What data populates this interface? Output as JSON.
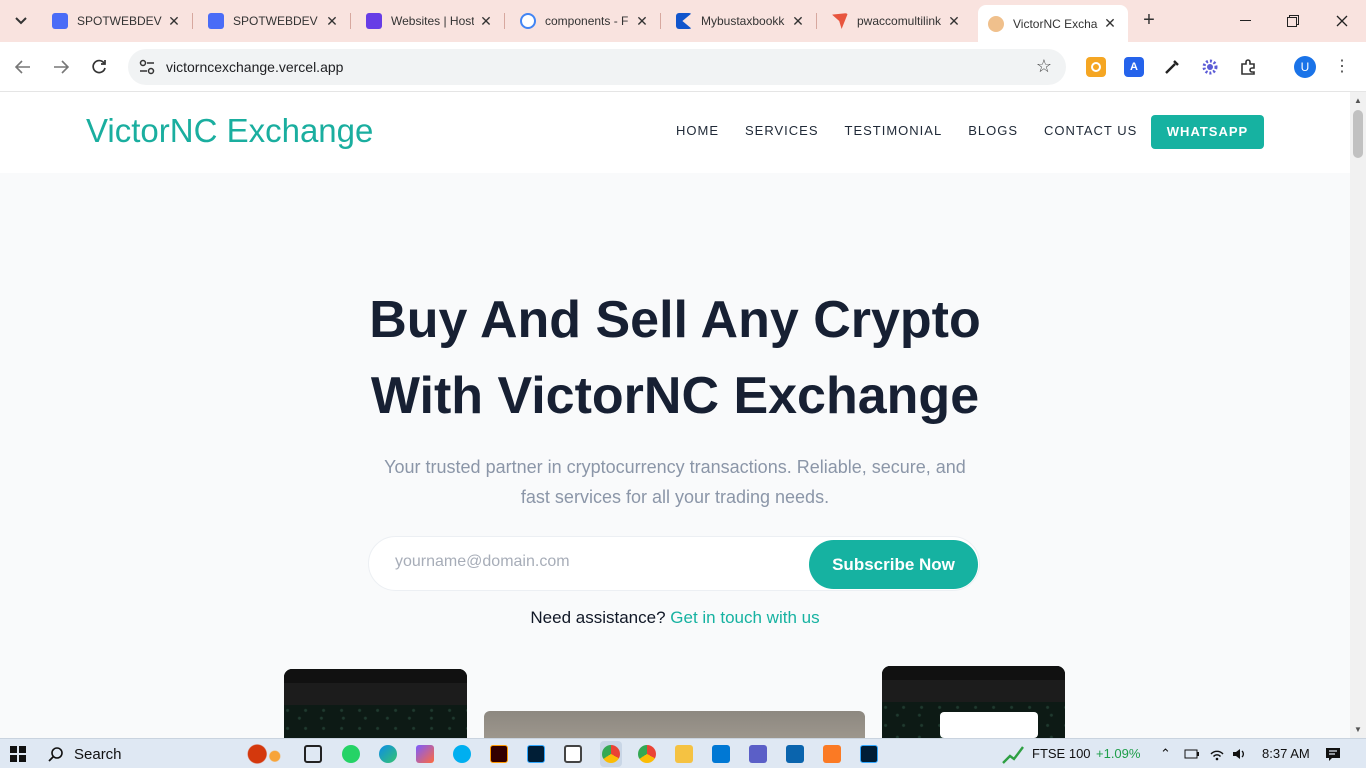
{
  "browser": {
    "tabs": [
      {
        "title": "SPOTWEBDEV - ",
        "color": "#4a6cf7"
      },
      {
        "title": "SPOTWEBDEV - ",
        "color": "#4a6cf7"
      },
      {
        "title": "Websites | Host",
        "color": "#673de6"
      },
      {
        "title": "components - F",
        "color": "#4285f4"
      },
      {
        "title": "Mybustaxbookk",
        "color": "#1155cc"
      },
      {
        "title": "pwaccomultilink",
        "color": "#e8553e"
      },
      {
        "title": "VictorNC Excha",
        "color": "#f0c08c"
      }
    ],
    "close_glyph": "✕",
    "url": "victorncexchange.vercel.app",
    "profile_initial": "U"
  },
  "site": {
    "logo": "VictorNC Exchange",
    "nav": [
      "HOME",
      "SERVICES",
      "TESTIMONIAL",
      "BLOGS",
      "CONTACT US"
    ],
    "cta": "WHATSAPP",
    "hero_line1": "Buy And Sell Any Crypto",
    "hero_line2": "With VictorNC Exchange",
    "subtitle_line1": "Your trusted partner in cryptocurrency transactions. Reliable, secure, and",
    "subtitle_line2": "fast services for all your trading needs.",
    "email_placeholder": "yourname@domain.com",
    "subscribe_label": "Subscribe Now",
    "assist_text": "Need assistance? ",
    "assist_link": "Get in touch with us",
    "accent_color": "#16b2a1"
  },
  "taskbar": {
    "search_label": "Search",
    "ticker_name": "FTSE 100",
    "ticker_change": "+1.09%",
    "time": "8:37 AM"
  }
}
